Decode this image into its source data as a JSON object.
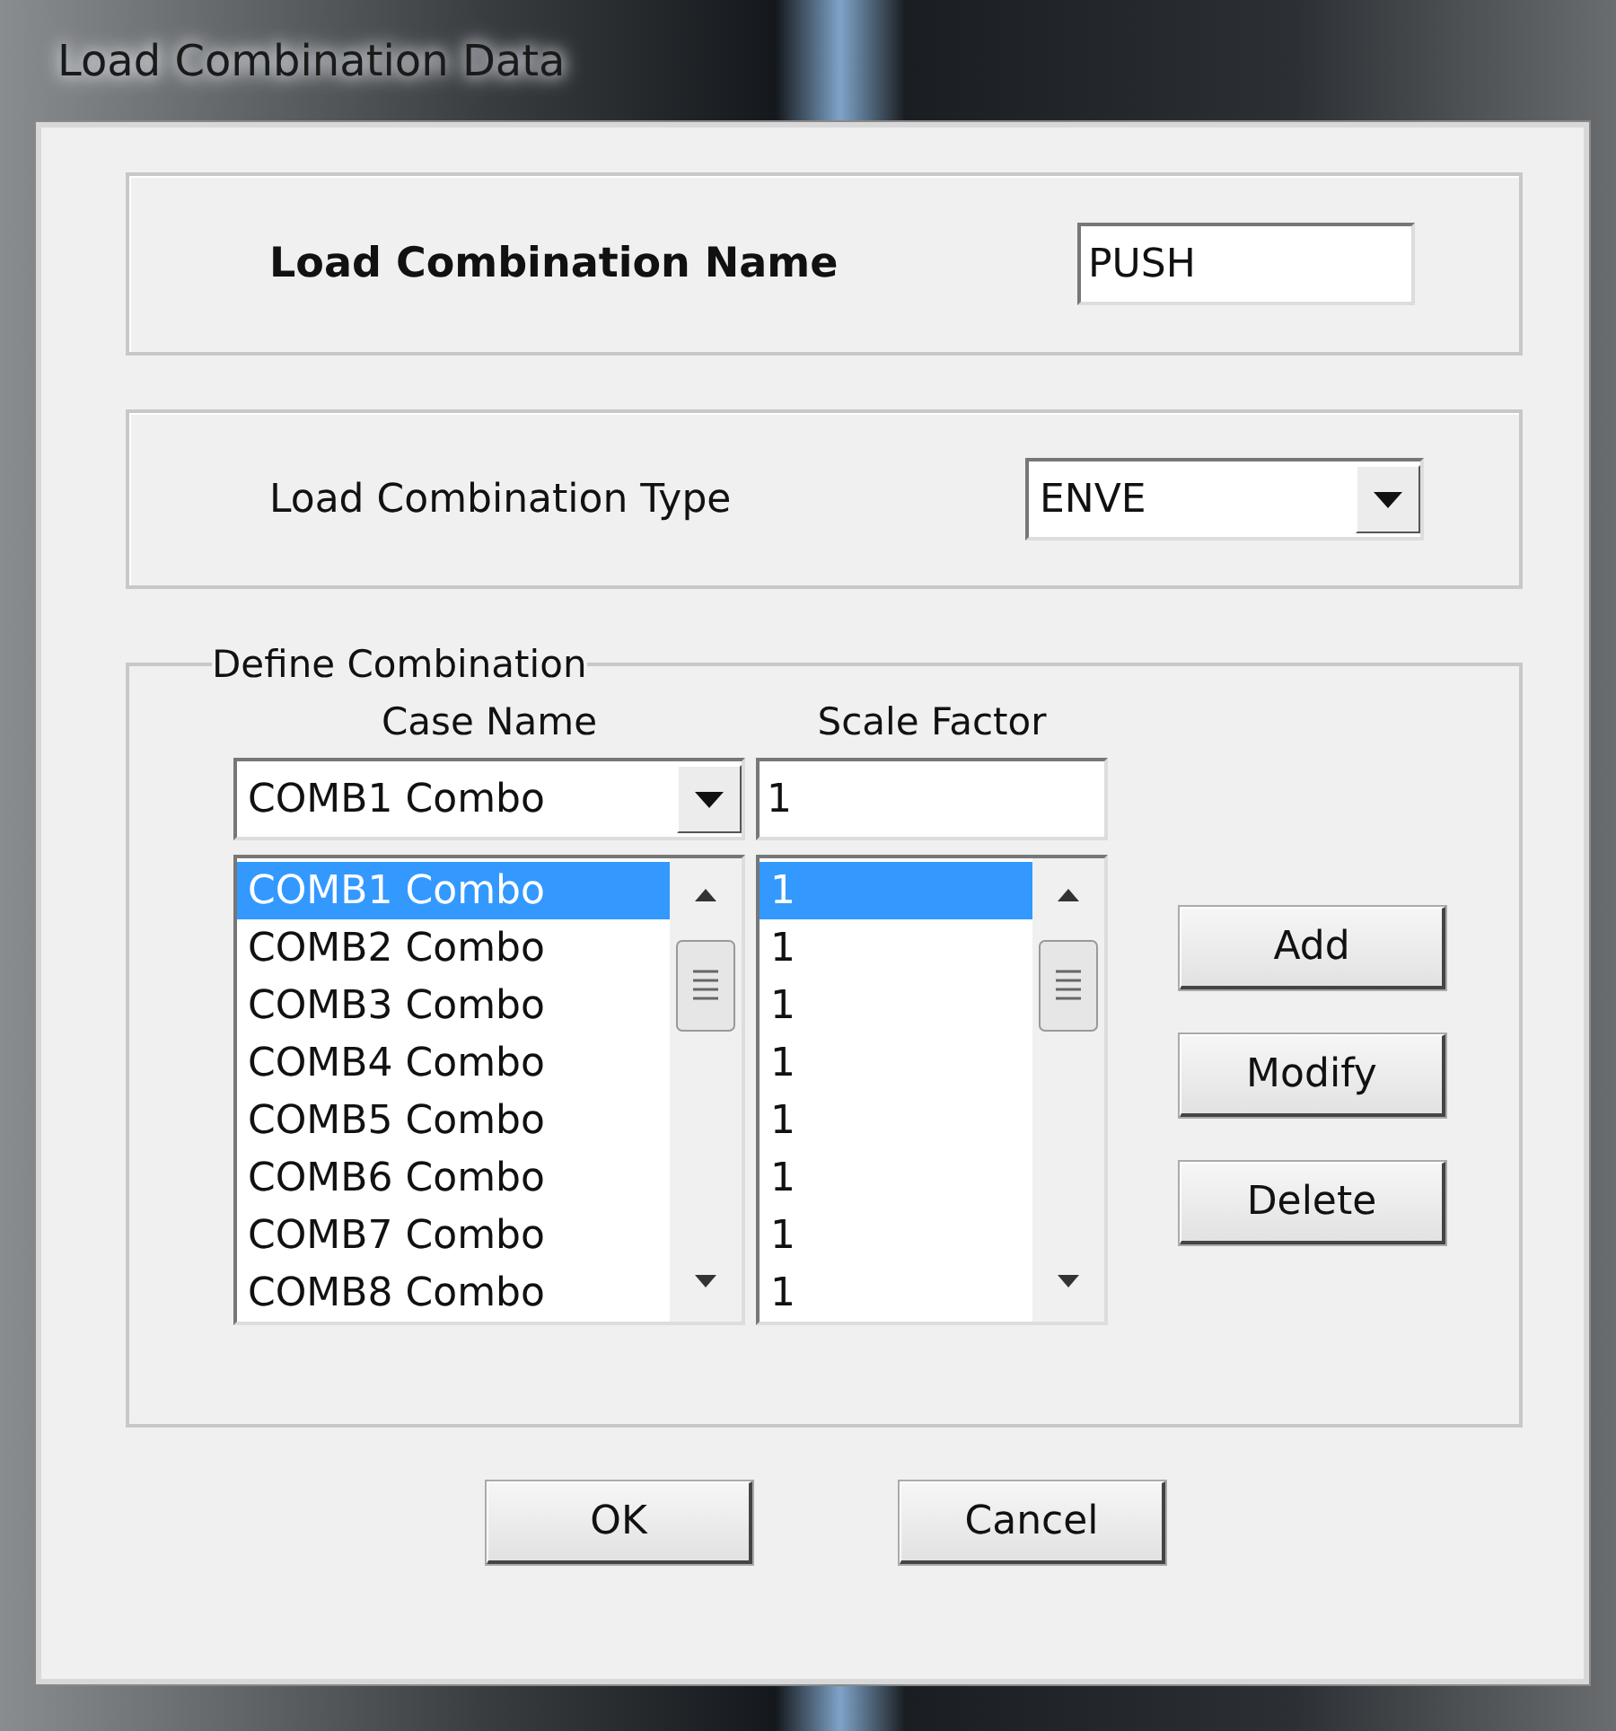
{
  "window": {
    "title": "Load Combination Data"
  },
  "name_section": {
    "label": "Load Combination Name",
    "value": "PUSH"
  },
  "type_section": {
    "label": "Load Combination Type",
    "value": "ENVE"
  },
  "define_combination": {
    "title": "Define Combination",
    "case_header": "Case Name",
    "scale_header": "Scale Factor",
    "case_select": "COMB1 Combo",
    "scale_input": "1",
    "rows": [
      {
        "case": "COMB1 Combo",
        "scale": "1",
        "selected": true
      },
      {
        "case": "COMB2 Combo",
        "scale": "1",
        "selected": false
      },
      {
        "case": "COMB3 Combo",
        "scale": "1",
        "selected": false
      },
      {
        "case": "COMB4 Combo",
        "scale": "1",
        "selected": false
      },
      {
        "case": "COMB5 Combo",
        "scale": "1",
        "selected": false
      },
      {
        "case": "COMB6 Combo",
        "scale": "1",
        "selected": false
      },
      {
        "case": "COMB7 Combo",
        "scale": "1",
        "selected": false
      },
      {
        "case": "COMB8 Combo",
        "scale": "1",
        "selected": false
      }
    ],
    "buttons": [
      "Add",
      "Modify",
      "Delete"
    ]
  },
  "buttons": [
    "OK",
    "Cancel"
  ]
}
